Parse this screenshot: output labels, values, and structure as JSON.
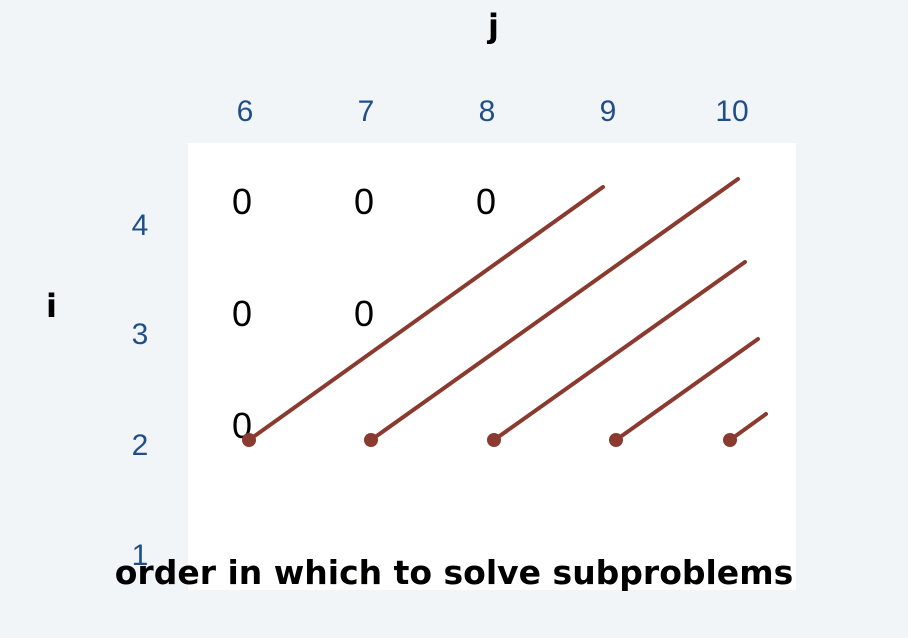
{
  "axes": {
    "column_title": "j",
    "row_title": "i"
  },
  "columns": [
    "6",
    "7",
    "8",
    "9",
    "10"
  ],
  "rows": [
    "4",
    "3",
    "2",
    "1"
  ],
  "cells": {
    "row4": [
      "0",
      "0",
      "0"
    ],
    "row3": [
      "0",
      "0"
    ],
    "row2": [
      "0"
    ]
  },
  "caption": "order in which to solve subproblems",
  "colors": {
    "background": "#f2f5f8",
    "panel": "#ffffff",
    "axis_labels": "#1f4e8a",
    "arrows": "#8a3a2e"
  }
}
